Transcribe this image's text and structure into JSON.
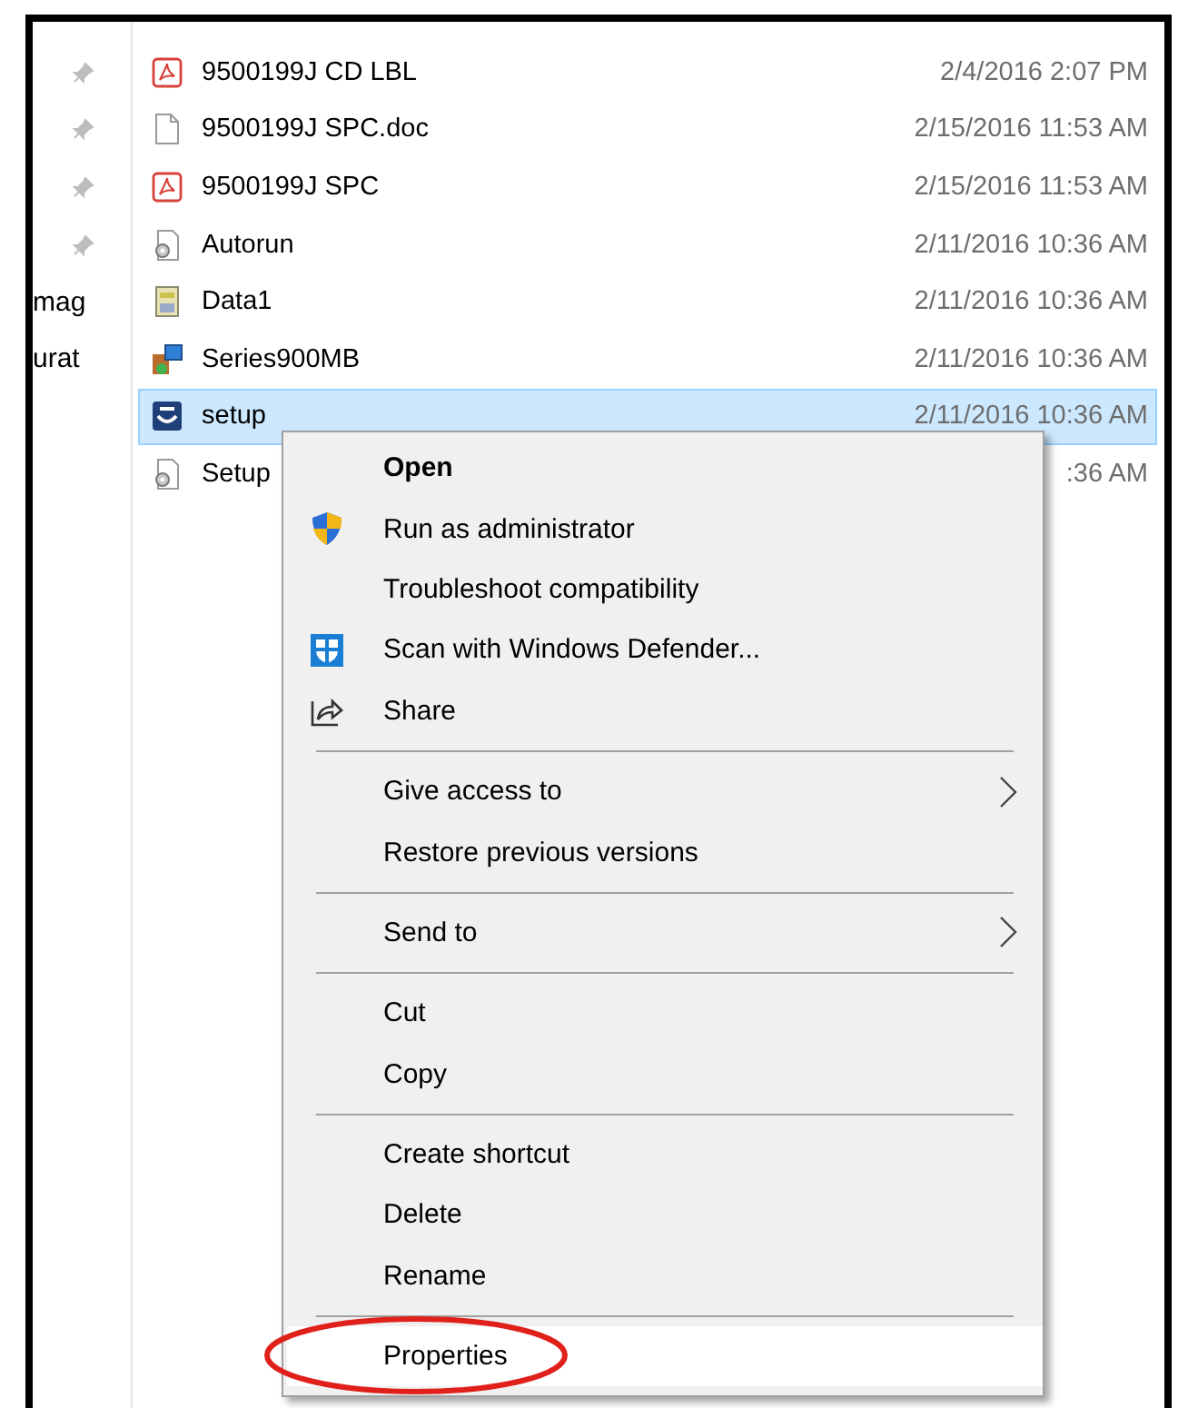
{
  "quick_access": [
    {
      "pinned": true
    },
    {
      "pinned": true
    },
    {
      "pinned": true
    },
    {
      "pinned": true
    },
    {
      "pinned": false,
      "label": "mag"
    },
    {
      "pinned": false,
      "label": "urat"
    }
  ],
  "files": [
    {
      "kind": "pdf",
      "name": "9500199J CD LBL",
      "date": "2/4/2016 2:07 PM",
      "selected": false
    },
    {
      "kind": "doc",
      "name": "9500199J SPC.doc",
      "date": "2/15/2016 11:53 AM",
      "selected": false
    },
    {
      "kind": "pdf",
      "name": "9500199J SPC",
      "date": "2/15/2016 11:53 AM",
      "selected": false
    },
    {
      "kind": "gear",
      "name": "Autorun",
      "date": "2/11/2016 10:36 AM",
      "selected": false
    },
    {
      "kind": "data",
      "name": "Data1",
      "date": "2/11/2016 10:36 AM",
      "selected": false
    },
    {
      "kind": "installer",
      "name": "Series900MB",
      "date": "2/11/2016 10:36 AM",
      "selected": false
    },
    {
      "kind": "setup",
      "name": "setup",
      "date": "2/11/2016 10:36 AM",
      "selected": true
    },
    {
      "kind": "gear",
      "name": "Setup",
      "date": ":36 AM",
      "selected": false
    }
  ],
  "context_menu": {
    "items": [
      {
        "kind": "item",
        "label": "Open",
        "default": true
      },
      {
        "kind": "shield",
        "label": "Run as administrator"
      },
      {
        "kind": "item",
        "label": "Troubleshoot compatibility"
      },
      {
        "kind": "defender",
        "label": "Scan with Windows Defender..."
      },
      {
        "kind": "share",
        "label": "Share"
      },
      {
        "kind": "separator"
      },
      {
        "kind": "item",
        "label": "Give access to",
        "submenu": true
      },
      {
        "kind": "item",
        "label": "Restore previous versions"
      },
      {
        "kind": "separator"
      },
      {
        "kind": "item",
        "label": "Send to",
        "submenu": true
      },
      {
        "kind": "separator"
      },
      {
        "kind": "item",
        "label": "Cut"
      },
      {
        "kind": "item",
        "label": "Copy"
      },
      {
        "kind": "separator"
      },
      {
        "kind": "item",
        "label": "Create shortcut"
      },
      {
        "kind": "item",
        "label": "Delete"
      },
      {
        "kind": "item",
        "label": "Rename"
      },
      {
        "kind": "separator"
      },
      {
        "kind": "item",
        "label": "Properties",
        "highlighted": true,
        "circled": true
      }
    ]
  }
}
